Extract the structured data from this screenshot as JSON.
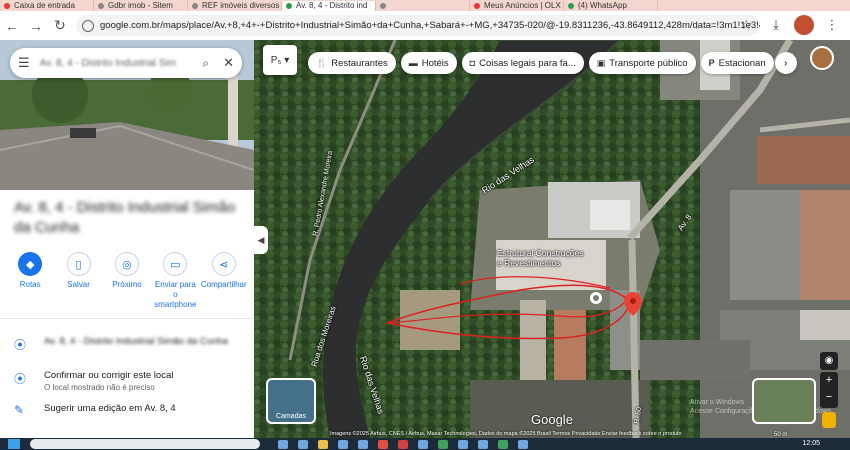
{
  "browser": {
    "tabs": [
      {
        "label": "Caixa de entrada",
        "color": "red"
      },
      {
        "label": "Gdbr imob - Sitem",
        "color": "gray"
      },
      {
        "label": "REF imóveis diversos",
        "color": "gray"
      },
      {
        "label": "Av. 8, 4 - Distrito ind",
        "color": "green",
        "active": true
      },
      {
        "label": "",
        "color": "gray"
      },
      {
        "label": "Meus Anúncios | OLX",
        "color": "red"
      },
      {
        "label": "(4) WhatsApp",
        "color": "green"
      }
    ],
    "url": "google.com.br/maps/place/Av.+8,+4+-+Distrito+Industrial+Simão+da+Cunha,+Sabará+-+MG,+34735-020/@-19.8311236,-43.8649112,428m/data=!3m1!1e3!4..."
  },
  "panel": {
    "search_value": "Av. 8, 4 - Distrito Industrial Sim",
    "place_title": "Av. 8, 4 - Distrito Industrial Simão da Cunha",
    "actions": [
      {
        "label": "Rotas",
        "icon": "directions-icon"
      },
      {
        "label": "Salvar",
        "icon": "bookmark-icon"
      },
      {
        "label": "Próximo",
        "icon": "nearby-icon"
      },
      {
        "label": "Enviar para o smartphone",
        "icon": "phone-icon"
      },
      {
        "label": "Compartilhar",
        "icon": "share-icon"
      }
    ],
    "address_line": "Av. 8, 4 - Distrito Industrial Simão da Cunha",
    "confirm_title": "Confirmar ou corrigir este local",
    "confirm_sub": "O local mostrado não é preciso",
    "suggest_edit": "Sugerir uma edição em Av. 8, 4"
  },
  "map": {
    "chips": [
      {
        "label": "Restaurantes",
        "icon": "fork-knife-icon"
      },
      {
        "label": "Hotéis",
        "icon": "bed-icon"
      },
      {
        "label": "Coisas legais para fa...",
        "icon": "camera-icon"
      },
      {
        "label": "Transporte público",
        "icon": "train-icon"
      },
      {
        "label": "Estacionan",
        "icon": "parking-icon"
      }
    ],
    "labels": {
      "river_top": "Rio das Velhas",
      "river_bottom": "Rio das Velhas",
      "street_left": "R. Pedro Alexandre Moreira",
      "street_moreiras": "Rua dos Moreiras",
      "av8": "Av. 8",
      "r50": "R. 50"
    },
    "place_label": "Estrutural Construções e Revestimentos",
    "layers_label": "Camadas",
    "attribution": "Imagens ©2025 Airbus, CNES / Airbus, Maxar Technologies, Dados do mapa ©2025   Brasil   Termos   Privacidade   Enviar feedback sobre o produto",
    "scale": "50 m",
    "logo": "Google",
    "watermark": "Ativar o Windows\nAcesse Configurações para ativar o Windows."
  },
  "taskbar": {
    "clock": "12:05"
  }
}
